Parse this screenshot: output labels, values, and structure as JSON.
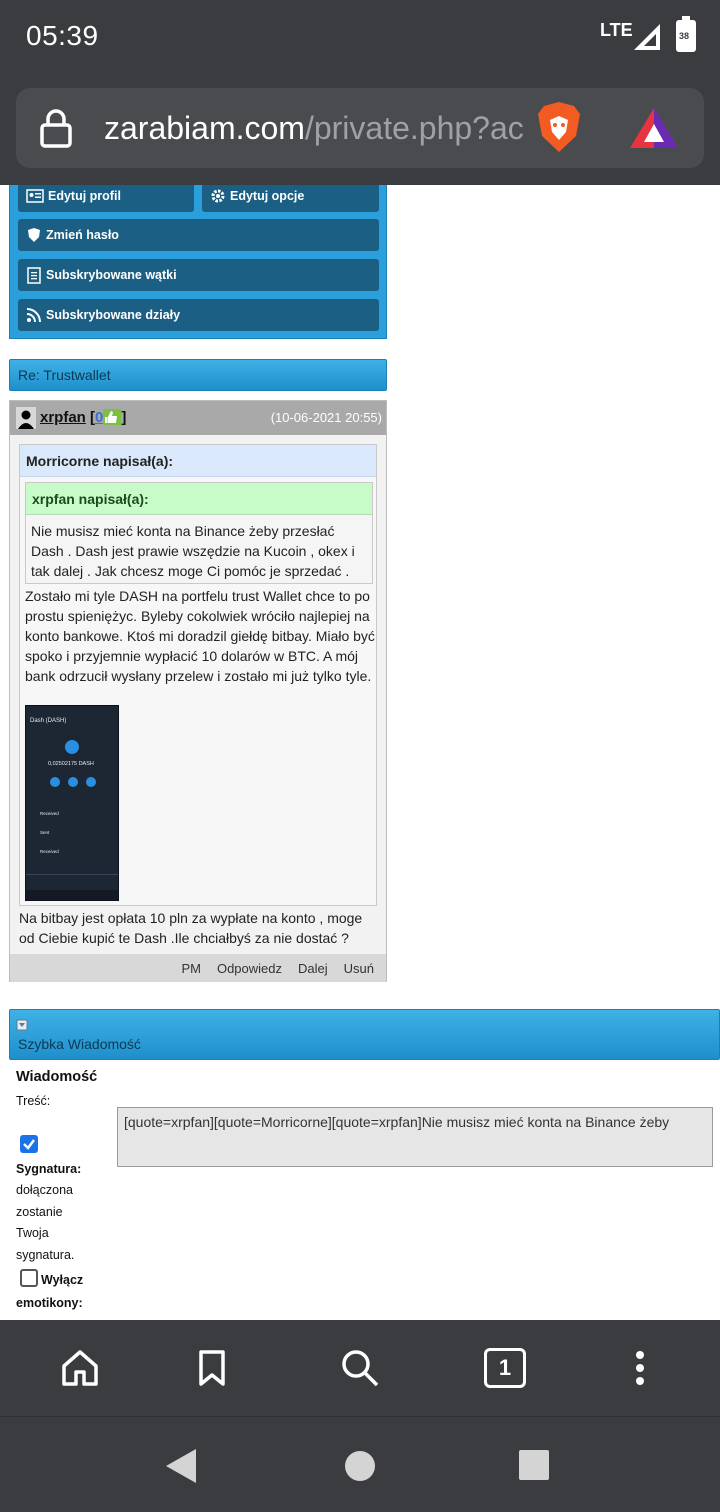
{
  "status": {
    "time": "05:39",
    "network": "LTE",
    "battery": "38"
  },
  "browser": {
    "url_host": "zarabiam.com",
    "url_path": "/private.php?ac",
    "tab_count": "1"
  },
  "menu": {
    "items": [
      {
        "label": "Edytuj profil",
        "icon": "id-card-icon"
      },
      {
        "label": "Edytuj opcje",
        "icon": "gear-icon"
      },
      {
        "label": "Zmień hasło",
        "icon": "shield-icon"
      },
      {
        "label": "Subskrybowane wątki",
        "icon": "notepad-icon"
      },
      {
        "label": "Subskrybowane działy",
        "icon": "rss-icon"
      }
    ]
  },
  "thread": {
    "title": "Re: Trustwallet"
  },
  "post": {
    "author": "xrpfan",
    "rep_open": "[",
    "rep_value": "0",
    "rep_close": "]",
    "date": "(10-06-2021 20:55)",
    "outer_quote_head": "Morricorne napisał(a):",
    "inner_quote_head": "xrpfan napisał(a):",
    "inner_quote_text": "Nie musisz mieć konta na Binance żeby przesłać Dash . Dash jest prawie wszędzie na Kucoin , okex i tak dalej . Jak chcesz moge Ci pomóc je sprzedać .",
    "outer_quote_text": "Zostało mi tyle DASH na portfelu trust Wallet chce to po prostu spieniężyc. Byleby cokolwiek wróciło najlepiej na konto bankowe. Ktoś mi doradzil giełdę bitbay. Miało być spoko i przyjemnie wypłacić 10 dolarów w BTC. A mój bank odrzucił wysłany przelew i zostało mi już tylko tyle.",
    "body_text": "Na bitbay jest opłata 10 pln za wypłate na konto , moge od Ciebie kupić te Dash .Ile chciałbyś za nie dostać ?",
    "screenshot": {
      "title": "Dash (DASH)",
      "balance": "0,02502175 DASH",
      "tx": [
        "Received",
        "Sent",
        "Received"
      ]
    },
    "actions": [
      "PM",
      "Odpowiedz",
      "Dalej",
      "Usuń"
    ]
  },
  "quick_reply": {
    "title": "Szybka Wiadomość",
    "heading": "Wiadomość",
    "content_label": "Treść:",
    "signature_label": "Sygnatura:",
    "signature_desc_1": "dołączona",
    "signature_desc_2": "zostanie",
    "signature_desc_3": "Twoja",
    "signature_desc_4": "sygnatura.",
    "signature_checked": true,
    "disable_emoticons_label_1": "Wyłącz",
    "disable_emoticons_label_2": "emotikony:",
    "disable_emoticons_checked": false,
    "textarea_value": "[quote=xrpfan][quote=Morricorne][quote=xrpfan]Nie musisz mieć konta na Binance żeby"
  },
  "colors": {
    "chrome": "#3b3c3f",
    "panel_blue": "#2a9fdc",
    "menu_button": "#1b5f85",
    "quote_blue": "#d9e8fb",
    "quote_green": "#c7fcc8"
  }
}
